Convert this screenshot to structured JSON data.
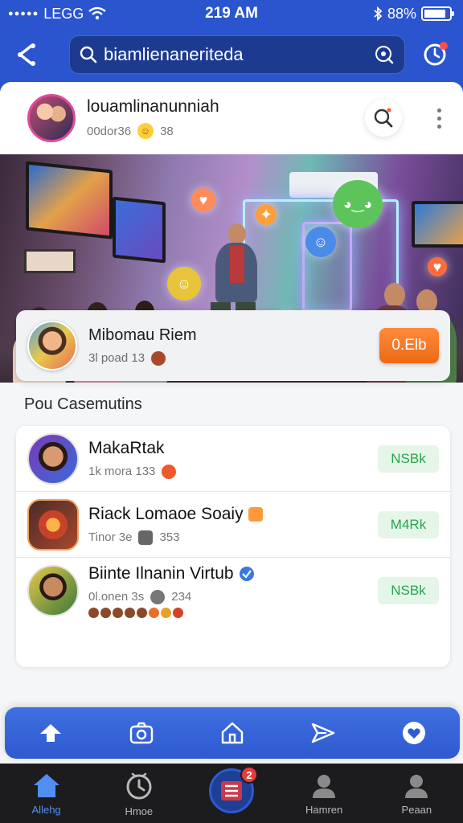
{
  "status_bar": {
    "carrier": "LEGG",
    "time": "219 AM",
    "battery": "88%",
    "battery_level": 0.88
  },
  "search": {
    "value": "biamlienaneriteda"
  },
  "post": {
    "author": "louamlinanunniah",
    "subtitle": "00dor36",
    "count": "38"
  },
  "featured": {
    "title": "Mibomau Riem",
    "subtitle": "3l poad 13",
    "button": "0.Elb"
  },
  "section_title": "Pou Casemutins",
  "list": [
    {
      "title": "MakaRtak",
      "subtitle": "1k mora 133",
      "pill": "NSBk"
    },
    {
      "title": "Riack Lomaoe Soaiy",
      "subtitle": "Tinor 3e",
      "count": "353",
      "pill": "M4Rk"
    },
    {
      "title": "Biinte Ilnanin Virtub",
      "subtitle": "0l.onen 3s",
      "count": "234",
      "pill": "NSBk"
    }
  ],
  "tabs": [
    {
      "label": "Allehg",
      "icon": "home-icon",
      "active": true
    },
    {
      "label": "Hmoe",
      "icon": "clock-icon",
      "active": false
    },
    {
      "label": "",
      "icon": "list-icon",
      "badge": "2",
      "active": false
    },
    {
      "label": "Hamren",
      "icon": "person-icon",
      "active": false
    },
    {
      "label": "Peaan",
      "icon": "person-icon",
      "active": false
    }
  ],
  "colors": {
    "brand_blue": "#2a55cf",
    "accent_orange": "#ec6a14",
    "pill_green": "#27a54a",
    "badge_red": "#e63b3b"
  }
}
